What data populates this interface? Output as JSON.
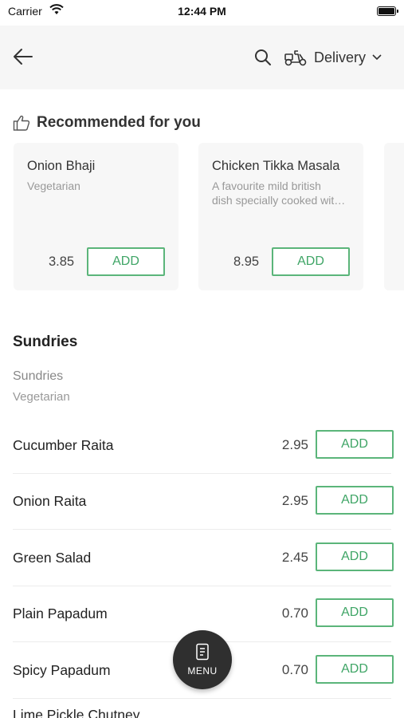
{
  "status_bar": {
    "carrier": "Carrier",
    "time": "12:44 PM"
  },
  "nav": {
    "delivery_label": "Delivery"
  },
  "recommended": {
    "title": "Recommended for you",
    "items": [
      {
        "name": "Onion Bhaji",
        "description": "Vegetarian",
        "price": "3.85",
        "add_label": "ADD"
      },
      {
        "name": "Chicken Tikka Masala",
        "description": "A favourite mild british\ndish specially cooked wit…",
        "price": "8.95",
        "add_label": "ADD"
      }
    ]
  },
  "section": {
    "title": "Sundries",
    "subtitle": "Sundries",
    "tag": "Vegetarian",
    "items": [
      {
        "name": "Cucumber Raita",
        "price": "2.95",
        "add_label": "ADD"
      },
      {
        "name": "Onion Raita",
        "price": "2.95",
        "add_label": "ADD"
      },
      {
        "name": "Green Salad",
        "price": "2.45",
        "add_label": "ADD"
      },
      {
        "name": "Plain Papadum",
        "price": "0.70",
        "add_label": "ADD"
      },
      {
        "name": "Spicy Papadum",
        "price": "0.70",
        "add_label": "ADD"
      },
      {
        "name": "Lime Pickle Chutney",
        "price": "",
        "add_label": ""
      }
    ]
  },
  "fab": {
    "label": "MENU"
  },
  "colors": {
    "accent_green": "#5bb57a",
    "navbar_bg": "#f6f6f6",
    "card_bg": "#f7f7f7",
    "fab_bg": "#2f2f2f"
  }
}
